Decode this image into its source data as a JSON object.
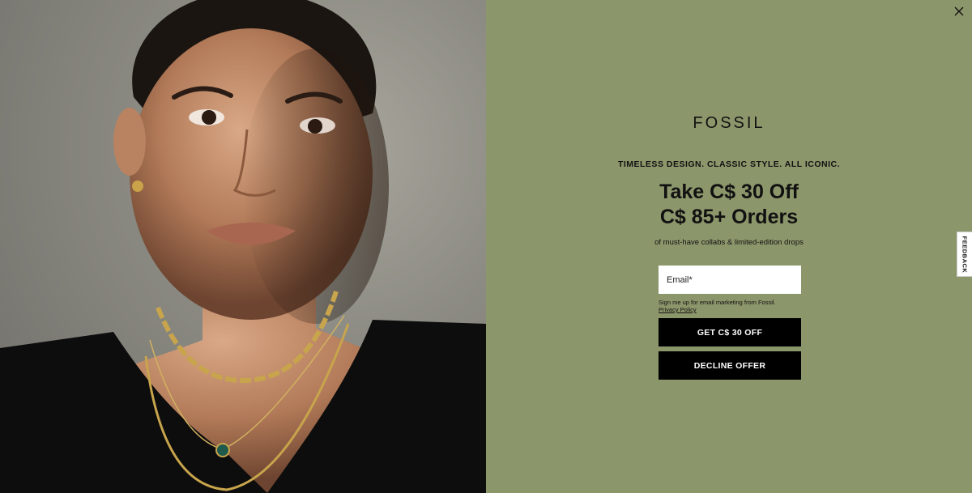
{
  "hero_image": {
    "alt": "Model wearing layered gold necklaces"
  },
  "modal": {
    "close_icon": "close-icon",
    "logo_text": "FOSSIL",
    "tagline": "TIMELESS DESIGN. CLASSIC STYLE. ALL ICONIC.",
    "headline_line1": "Take C$ 30 Off",
    "headline_line2": "C$ 85+ Orders",
    "subline": "of must-have collabs & limited-edition drops",
    "email_placeholder": "Email*",
    "email_value": "",
    "consent_text": "Sign me up for email marketing from Fossil.",
    "privacy_link": "Privacy Policy",
    "primary_button": "GET C$ 30 OFF",
    "secondary_button": "DECLINE OFFER"
  },
  "feedback_tab": {
    "label": "FEEDBACK"
  },
  "colors": {
    "panel_bg": "#8c966b",
    "button_bg": "#000000",
    "button_text": "#ffffff"
  }
}
